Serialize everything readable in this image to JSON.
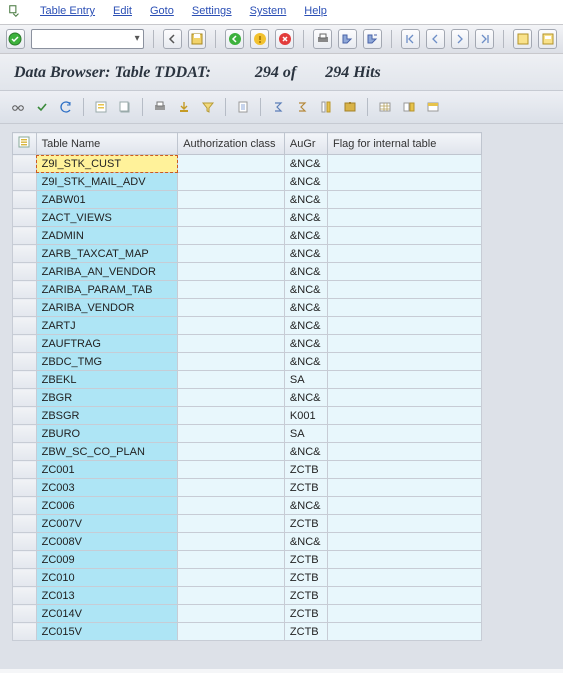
{
  "menu": {
    "table_entry": "Table Entry",
    "edit": "Edit",
    "goto": "Goto",
    "settings": "Settings",
    "system": "System",
    "help": "Help"
  },
  "title": {
    "prefix": "Data Browser: Table TDDAT:",
    "count": "294 of",
    "total": "294 Hits"
  },
  "columns": {
    "name": "Table Name",
    "auth": "Authorization class",
    "augr": "AuGr",
    "flag": "Flag for internal table"
  },
  "rows": [
    {
      "name": "Z9I_STK_CUST",
      "augr": "&NC&",
      "selected": true
    },
    {
      "name": "Z9I_STK_MAIL_ADV",
      "augr": "&NC&"
    },
    {
      "name": "ZABW01",
      "augr": "&NC&"
    },
    {
      "name": "ZACT_VIEWS",
      "augr": "&NC&"
    },
    {
      "name": "ZADMIN",
      "augr": "&NC&"
    },
    {
      "name": "ZARB_TAXCAT_MAP",
      "augr": "&NC&"
    },
    {
      "name": "ZARIBA_AN_VENDOR",
      "augr": "&NC&"
    },
    {
      "name": "ZARIBA_PARAM_TAB",
      "augr": "&NC&"
    },
    {
      "name": "ZARIBA_VENDOR",
      "augr": "&NC&"
    },
    {
      "name": "ZARTJ",
      "augr": "&NC&"
    },
    {
      "name": "ZAUFTRAG",
      "augr": "&NC&"
    },
    {
      "name": "ZBDC_TMG",
      "augr": "&NC&"
    },
    {
      "name": "ZBEKL",
      "augr": "SA"
    },
    {
      "name": "ZBGR",
      "augr": "&NC&"
    },
    {
      "name": "ZBSGR",
      "augr": "K001"
    },
    {
      "name": "ZBURO",
      "augr": "SA"
    },
    {
      "name": "ZBW_SC_CO_PLAN",
      "augr": "&NC&"
    },
    {
      "name": "ZC001",
      "augr": "ZCTB"
    },
    {
      "name": "ZC003",
      "augr": "ZCTB"
    },
    {
      "name": "ZC006",
      "augr": "&NC&"
    },
    {
      "name": "ZC007V",
      "augr": "ZCTB"
    },
    {
      "name": "ZC008V",
      "augr": "&NC&"
    },
    {
      "name": "ZC009",
      "augr": "ZCTB"
    },
    {
      "name": "ZC010",
      "augr": "ZCTB"
    },
    {
      "name": "ZC013",
      "augr": "ZCTB"
    },
    {
      "name": "ZC014V",
      "augr": "ZCTB"
    },
    {
      "name": "ZC015V",
      "augr": "ZCTB"
    }
  ]
}
